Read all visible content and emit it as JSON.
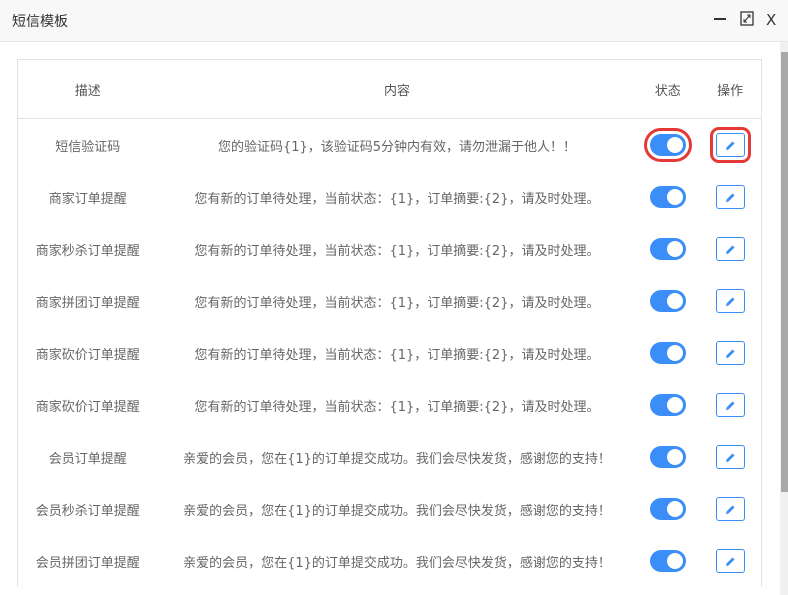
{
  "window": {
    "title": "短信模板",
    "minimize_icon": "minimize-icon",
    "maximize_icon": "maximize-icon",
    "close_label": "X"
  },
  "table": {
    "headers": [
      "描述",
      "内容",
      "状态",
      "操作"
    ],
    "rows": [
      {
        "desc": "短信验证码",
        "content": "您的验证码{1}，该验证码5分钟内有效，请勿泄漏于他人！！",
        "enabled": true
      },
      {
        "desc": "商家订单提醒",
        "content": "您有新的订单待处理，当前状态：{1}，订单摘要:{2}，请及时处理。",
        "enabled": true
      },
      {
        "desc": "商家秒杀订单提醒",
        "content": "您有新的订单待处理，当前状态：{1}，订单摘要:{2}，请及时处理。",
        "enabled": true
      },
      {
        "desc": "商家拼团订单提醒",
        "content": "您有新的订单待处理，当前状态：{1}，订单摘要:{2}，请及时处理。",
        "enabled": true
      },
      {
        "desc": "商家砍价订单提醒",
        "content": "您有新的订单待处理，当前状态：{1}，订单摘要:{2}，请及时处理。",
        "enabled": true
      },
      {
        "desc": "商家砍价订单提醒",
        "content": "您有新的订单待处理，当前状态：{1}，订单摘要:{2}，请及时处理。",
        "enabled": true
      },
      {
        "desc": "会员订单提醒",
        "content": "亲爱的会员，您在{1}的订单提交成功。我们会尽快发货，感谢您的支持！",
        "enabled": true
      },
      {
        "desc": "会员秒杀订单提醒",
        "content": "亲爱的会员，您在{1}的订单提交成功。我们会尽快发货，感谢您的支持！",
        "enabled": true
      },
      {
        "desc": "会员拼团订单提醒",
        "content": "亲爱的会员，您在{1}的订单提交成功。我们会尽快发货，感谢您的支持！",
        "enabled": true
      }
    ]
  },
  "colors": {
    "accent": "#3b8ef7",
    "highlight": "#e53935"
  }
}
